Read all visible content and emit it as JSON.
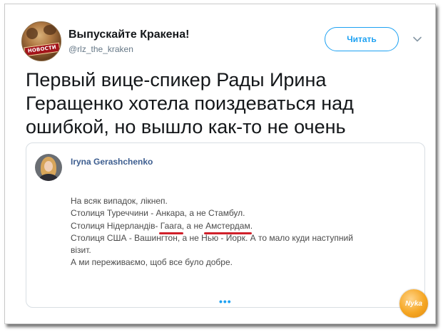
{
  "account": {
    "name": "Выпускайте Кракена!",
    "handle": "@rlz_the_kraken",
    "avatar_banner": "НОВОСТИ"
  },
  "follow_label": "Читать",
  "tweet_text": "Первый вице-спикер Рады Ирина Геращенко хотела поиздеваться над ошибкой, но вышло как-то не очень",
  "quote": {
    "name": "Iryna Gerashchenko",
    "lines": {
      "l1": "На всяк випадок, лікнеп.",
      "l2": "Столиця Туреччини - Анкара, а не Стамбул.",
      "l3_pre": "Столиця Нідерландів- ",
      "l3_u1": "Гаага",
      "l3_mid": ", а не ",
      "l3_u2": "Амстердам",
      "l3_post": ".",
      "l4": "Столиця США - Вашингтон, а не Нью - Йорк. А то мало куди наступний",
      "l5": "візит.",
      "l6": "А ми переживаємо, щоб все було добре."
    },
    "more": "•••"
  },
  "watermark": "Nyka",
  "colors": {
    "accent": "#1da1f2",
    "quote_name": "#3c5d8f",
    "underline": "#d0202a",
    "watermark": "#f5a623"
  },
  "icons": {
    "caret": "chevron-down-icon"
  }
}
